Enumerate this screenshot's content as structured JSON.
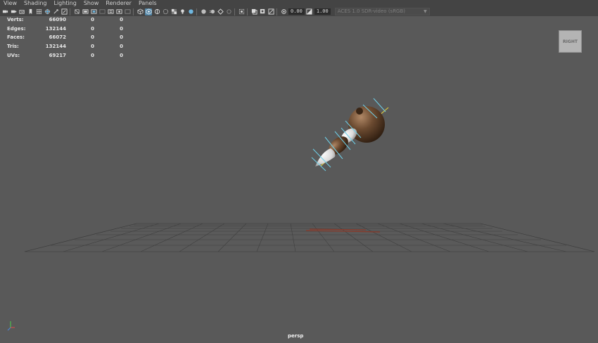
{
  "menu": [
    "View",
    "Shading",
    "Lighting",
    "Show",
    "Renderer",
    "Panels"
  ],
  "toolbar": {
    "exposure_value": "0.00",
    "gamma_value": "1.00",
    "color_management": "ACES 1.0 SDR-video (sRGB)"
  },
  "heads_up": {
    "rows": [
      {
        "label": "Verts:",
        "total": "66090",
        "selected": "0",
        "selected_uv": "0"
      },
      {
        "label": "Edges:",
        "total": "132144",
        "selected": "0",
        "selected_uv": "0"
      },
      {
        "label": "Faces:",
        "total": "66072",
        "selected": "0",
        "selected_uv": "0"
      },
      {
        "label": "Tris:",
        "total": "132144",
        "selected": "0",
        "selected_uv": "0"
      },
      {
        "label": "UVs:",
        "total": "69217",
        "selected": "0",
        "selected_uv": "0"
      }
    ]
  },
  "viewcube": {
    "label": "RIGHT"
  },
  "camera": {
    "name": "persp"
  },
  "colors": {
    "viewport_bg": "#595959",
    "toolbar_bg": "#444444",
    "active_icon": "#5285a6",
    "brown_material": "#6b4a30",
    "joint_ring": "#6fd0e8",
    "bone_line": "#e7d33c"
  }
}
